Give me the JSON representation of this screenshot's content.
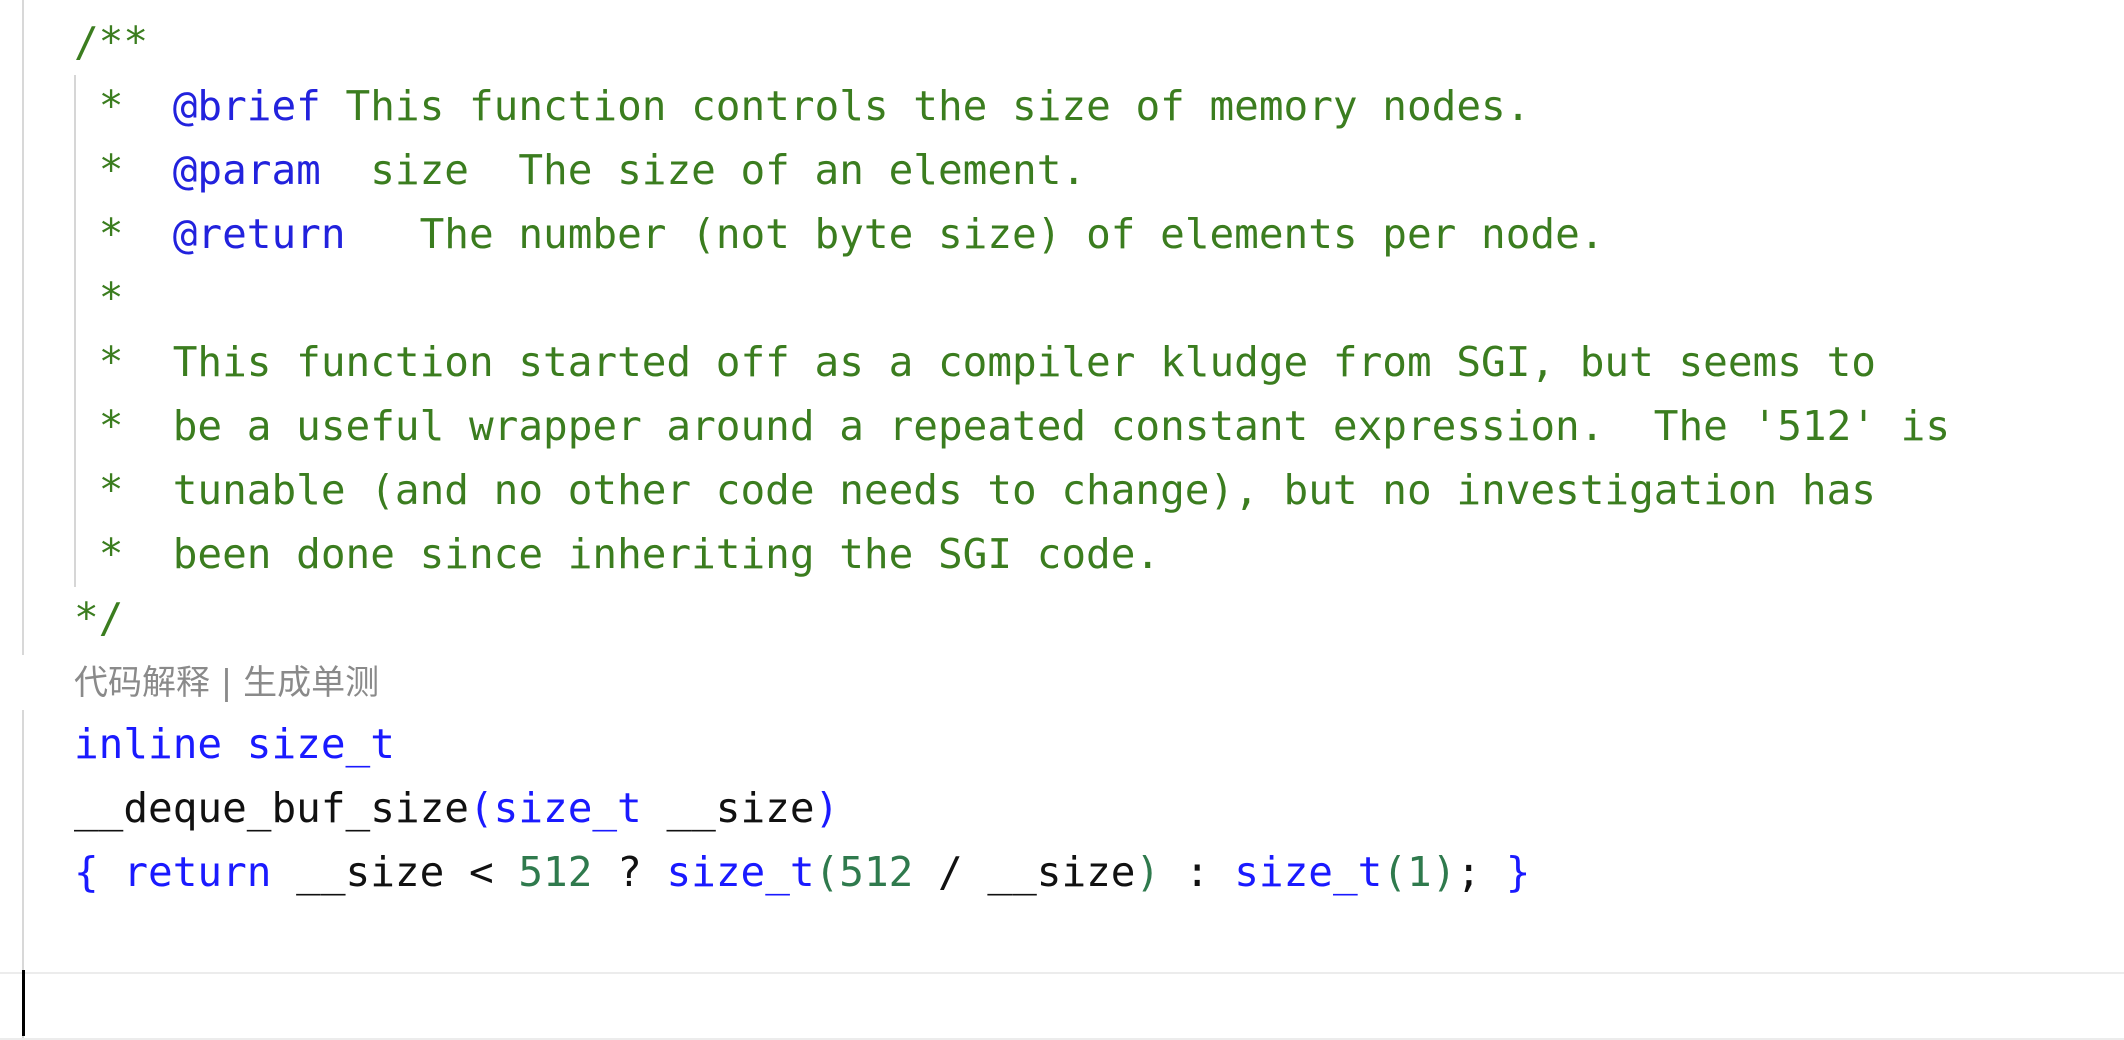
{
  "comment": {
    "open": "/**",
    "star": "*",
    "lines": [
      {
        "tag": "@brief",
        "text": "This function controls the size of memory nodes."
      },
      {
        "tag": "@param",
        "text": "size  The size of an element."
      },
      {
        "tag": "@return",
        "text": "The number (not byte size) of elements per node."
      },
      {
        "tag": "",
        "text": ""
      },
      {
        "tag": "",
        "text": "This function started off as a compiler kludge from SGI, but seems to"
      },
      {
        "tag": "",
        "text": "be a useful wrapper around a repeated constant expression.  The '512' is"
      },
      {
        "tag": "",
        "text": "tunable (and no other code needs to change), but no investigation has"
      },
      {
        "tag": "",
        "text": "been done since inheriting the SGI code."
      }
    ],
    "close": "*/"
  },
  "codelens": {
    "explain": "代码解释",
    "separator": " | ",
    "unit_test": "生成单测"
  },
  "code": {
    "line1": {
      "kw": "inline",
      "type": "size_t"
    },
    "line2": {
      "name": "__deque_buf_size",
      "open": "(",
      "param_type": "size_t",
      "param": "__size",
      "close": ")"
    },
    "line3": {
      "brace_open": "{",
      "ret": "return",
      "var1": "__size",
      "lt": "<",
      "n1": "512",
      "q": "?",
      "t1": "size_t",
      "p1": "(",
      "n2": "512",
      "div": "/",
      "var2": "__size",
      "p2": ")",
      "colon": ":",
      "t2": "size_t",
      "p3": "(",
      "n3": "1",
      "p4": ")",
      "semi": ";",
      "brace_close": "}"
    }
  },
  "colors": {
    "comment": "#3b7d1f",
    "keyword": "#1a1aff",
    "number": "#2f7a4d",
    "codelens": "#8a8a8a"
  }
}
